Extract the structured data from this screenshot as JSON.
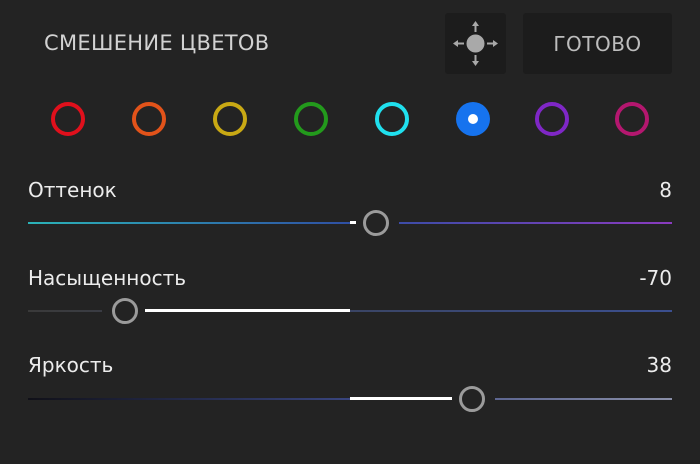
{
  "header": {
    "title": "СМЕШЕНИЕ ЦВЕТОВ",
    "move_icon": "move-arrows-icon",
    "done_label": "ГОТОВО"
  },
  "swatches": [
    {
      "name": "red",
      "color": "#e0101c",
      "selected": false
    },
    {
      "name": "orange",
      "color": "#e2531a",
      "selected": false
    },
    {
      "name": "yellow",
      "color": "#c9a914",
      "selected": false
    },
    {
      "name": "green",
      "color": "#239a1c",
      "selected": false
    },
    {
      "name": "aqua",
      "color": "#20e0ee",
      "selected": false
    },
    {
      "name": "blue",
      "color": "#1673ee",
      "selected": true
    },
    {
      "name": "purple",
      "color": "#7f27c6",
      "selected": false
    },
    {
      "name": "magenta",
      "color": "#b4176f",
      "selected": false
    }
  ],
  "sliders": [
    {
      "label": "Оттенок",
      "value": "8",
      "numeric": 8,
      "range": [
        -100,
        100
      ],
      "gradient": [
        "#2bb3b8",
        "#2f4fa3",
        "#8a3bbf"
      ]
    },
    {
      "label": "Насыщенность",
      "value": "-70",
      "numeric": -70,
      "range": [
        -100,
        100
      ],
      "gradient": [
        "#3a3a3a",
        "#3b4f8f"
      ]
    },
    {
      "label": "Яркость",
      "value": "38",
      "numeric": 38,
      "range": [
        -100,
        100
      ],
      "gradient": [
        "#101018",
        "#39457e",
        "#8a8fa8"
      ]
    }
  ]
}
